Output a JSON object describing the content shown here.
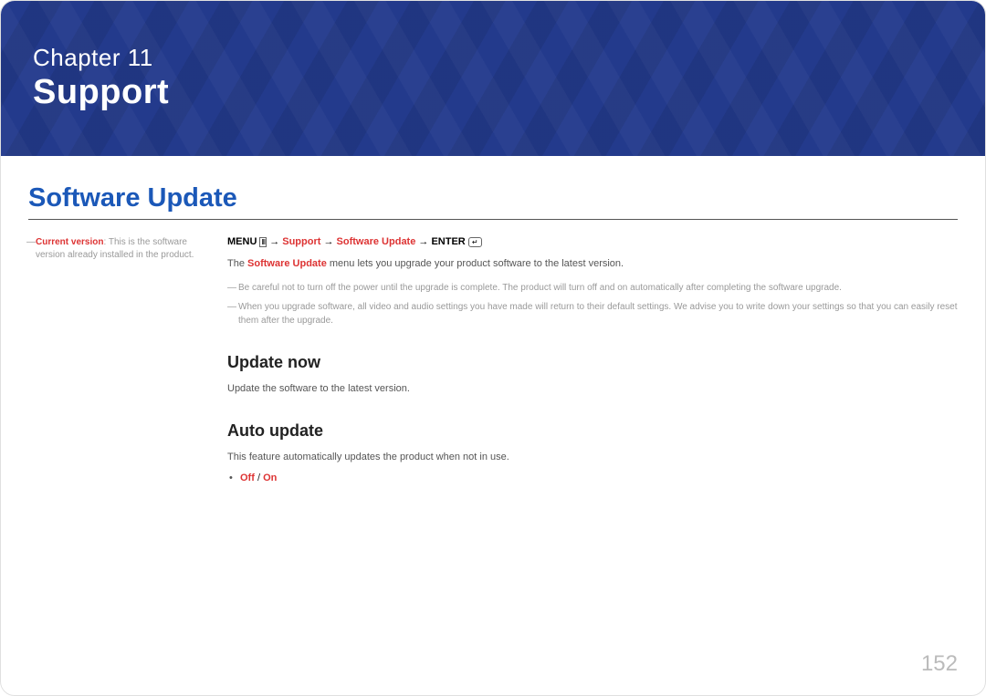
{
  "chapter": {
    "label": "Chapter  11",
    "title": "Support"
  },
  "main_heading": "Software Update",
  "side_note": {
    "red_label": "Current version",
    "text": ": This is the software version already installed in the product."
  },
  "breadcrumb": {
    "menu": "MENU",
    "arrow": " → ",
    "part1": "Support",
    "part2": "Software Update",
    "enter": "ENTER"
  },
  "intro": {
    "prefix": "The ",
    "highlight": "Software Update",
    "suffix": " menu lets you upgrade your product software to the latest version."
  },
  "dash_notes": [
    "Be careful not to turn off the power until the upgrade is complete. The product will turn off and on automatically after completing the software upgrade.",
    "When you upgrade software, all video and audio settings you have made will return to their default settings. We advise you to write down your settings so that you can easily reset them after the upgrade."
  ],
  "sections": [
    {
      "heading": "Update now",
      "text": "Update the software to the latest version."
    },
    {
      "heading": "Auto update",
      "text": "This feature automatically updates the product when not in use.",
      "bullet_red": "Off",
      "bullet_sep": " / ",
      "bullet_red2": "On"
    }
  ],
  "page_number": "152"
}
